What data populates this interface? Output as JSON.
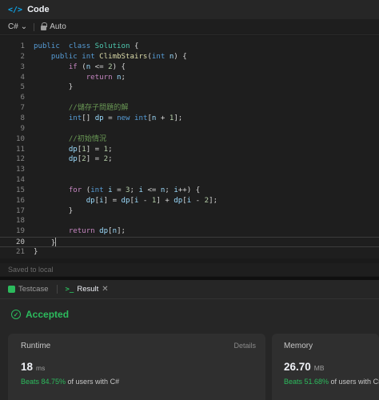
{
  "header": {
    "title": "Code",
    "icon": "code-brackets-icon"
  },
  "toolbar": {
    "language": "C#",
    "mode": "Auto"
  },
  "editor": {
    "lines": [
      {
        "n": "1",
        "indent": "",
        "tokens": [
          [
            "kw",
            "public"
          ],
          [
            "",
            "  "
          ],
          [
            "kw",
            "class"
          ],
          [
            "",
            " "
          ],
          [
            "type",
            "Solution"
          ],
          [
            "",
            " {"
          ]
        ]
      },
      {
        "n": "2",
        "tokens": []
      },
      {
        "n": "3",
        "tokens": []
      },
      {
        "n": "4",
        "tokens": []
      },
      {
        "n": "5",
        "tokens": []
      },
      {
        "n": "6",
        "tokens": []
      },
      {
        "n": "7",
        "tokens": []
      },
      {
        "n": "8",
        "tokens": []
      },
      {
        "n": "9",
        "tokens": []
      },
      {
        "n": "10",
        "tokens": []
      },
      {
        "n": "11",
        "tokens": []
      },
      {
        "n": "12",
        "tokens": []
      },
      {
        "n": "13",
        "tokens": []
      },
      {
        "n": "14",
        "tokens": []
      },
      {
        "n": "15",
        "tokens": []
      },
      {
        "n": "16",
        "tokens": []
      },
      {
        "n": "17",
        "tokens": []
      },
      {
        "n": "18",
        "tokens": []
      },
      {
        "n": "19",
        "tokens": []
      },
      {
        "n": "20",
        "tokens": []
      },
      {
        "n": "21",
        "tokens": []
      }
    ],
    "current_line": "20"
  },
  "code_lines": [
    [
      [
        "kw",
        "public"
      ],
      [
        "",
        "  "
      ],
      [
        "kw",
        "class"
      ],
      [
        "",
        " "
      ],
      [
        "type",
        "Solution"
      ],
      [
        "",
        " {"
      ]
    ],
    [
      [
        "",
        "    "
      ],
      [
        "kw",
        "public"
      ],
      [
        "",
        " "
      ],
      [
        "kw",
        "int"
      ],
      [
        "",
        " "
      ],
      [
        "fn",
        "ClimbStairs"
      ],
      [
        "",
        "("
      ],
      [
        "kw",
        "int"
      ],
      [
        "",
        " "
      ],
      [
        "var",
        "n"
      ],
      [
        "",
        ") {"
      ]
    ],
    [
      [
        "",
        "        "
      ],
      [
        "ctl",
        "if"
      ],
      [
        "",
        " ("
      ],
      [
        "var",
        "n"
      ],
      [
        "",
        " <= "
      ],
      [
        "num",
        "2"
      ],
      [
        "",
        ") {"
      ]
    ],
    [
      [
        "",
        "            "
      ],
      [
        "ctl",
        "return"
      ],
      [
        "",
        " "
      ],
      [
        "var",
        "n"
      ],
      [
        "",
        ";"
      ]
    ],
    [
      [
        "",
        "        }"
      ]
    ],
    [
      [
        "",
        ""
      ]
    ],
    [
      [
        "",
        "        "
      ],
      [
        "cmt",
        "//儲存子問題的解"
      ]
    ],
    [
      [
        "",
        "        "
      ],
      [
        "kw",
        "int"
      ],
      [
        "",
        "[] "
      ],
      [
        "var",
        "dp"
      ],
      [
        "",
        " = "
      ],
      [
        "kw",
        "new"
      ],
      [
        "",
        " "
      ],
      [
        "kw",
        "int"
      ],
      [
        "",
        "["
      ],
      [
        "var",
        "n"
      ],
      [
        "",
        " + "
      ],
      [
        "num",
        "1"
      ],
      [
        "",
        "];"
      ]
    ],
    [
      [
        "",
        ""
      ]
    ],
    [
      [
        "",
        "        "
      ],
      [
        "cmt",
        "//初始情況"
      ]
    ],
    [
      [
        "",
        "        "
      ],
      [
        "var",
        "dp"
      ],
      [
        "",
        "["
      ],
      [
        "num",
        "1"
      ],
      [
        "",
        "] = "
      ],
      [
        "num",
        "1"
      ],
      [
        "",
        ";"
      ]
    ],
    [
      [
        "",
        "        "
      ],
      [
        "var",
        "dp"
      ],
      [
        "",
        "["
      ],
      [
        "num",
        "2"
      ],
      [
        "",
        "] = "
      ],
      [
        "num",
        "2"
      ],
      [
        "",
        ";"
      ]
    ],
    [
      [
        "",
        ""
      ]
    ],
    [
      [
        "",
        ""
      ]
    ],
    [
      [
        "",
        "        "
      ],
      [
        "ctl",
        "for"
      ],
      [
        "",
        " ("
      ],
      [
        "kw",
        "int"
      ],
      [
        "",
        " "
      ],
      [
        "var",
        "i"
      ],
      [
        "",
        " = "
      ],
      [
        "num",
        "3"
      ],
      [
        "",
        "; "
      ],
      [
        "var",
        "i"
      ],
      [
        "",
        " <= "
      ],
      [
        "var",
        "n"
      ],
      [
        "",
        "; "
      ],
      [
        "var",
        "i"
      ],
      [
        "",
        "++) {"
      ]
    ],
    [
      [
        "",
        "            "
      ],
      [
        "var",
        "dp"
      ],
      [
        "",
        "["
      ],
      [
        "var",
        "i"
      ],
      [
        "",
        "] = "
      ],
      [
        "var",
        "dp"
      ],
      [
        "",
        "["
      ],
      [
        "var",
        "i"
      ],
      [
        "",
        " - "
      ],
      [
        "num",
        "1"
      ],
      [
        "",
        "] + "
      ],
      [
        "var",
        "dp"
      ],
      [
        "",
        "["
      ],
      [
        "var",
        "i"
      ],
      [
        "",
        " - "
      ],
      [
        "num",
        "2"
      ],
      [
        "",
        "];"
      ]
    ],
    [
      [
        "",
        "        }"
      ]
    ],
    [
      [
        "",
        ""
      ]
    ],
    [
      [
        "",
        "        "
      ],
      [
        "ctl",
        "return"
      ],
      [
        "",
        " "
      ],
      [
        "var",
        "dp"
      ],
      [
        "",
        "["
      ],
      [
        "var",
        "n"
      ],
      [
        "",
        "];"
      ]
    ],
    [
      [
        "",
        "    }"
      ]
    ],
    [
      [
        "",
        "}"
      ]
    ]
  ],
  "status": {
    "saved": "Saved to local"
  },
  "tabs": [
    {
      "label": "Testcase",
      "icon": "testcase-box-icon"
    },
    {
      "label": "Result",
      "icon": "terminal-prompt-icon"
    }
  ],
  "result": {
    "status": "Accepted",
    "runtime": {
      "label": "Runtime",
      "details_label": "Details",
      "value": "18",
      "unit": "ms",
      "beats": "Beats 84.75%",
      "users": " of users with C#"
    },
    "memory": {
      "label": "Memory",
      "value": "26.70",
      "unit": "MB",
      "beats": "Beats 51.68%",
      "users": " of users with C#"
    }
  },
  "colors": {
    "accent_green": "#2cbb5d",
    "code_icon_blue": "#0ea5e9",
    "editor_bg": "#1e1e1e",
    "panel_bg": "#262626",
    "card_bg": "#2f2f2f"
  }
}
